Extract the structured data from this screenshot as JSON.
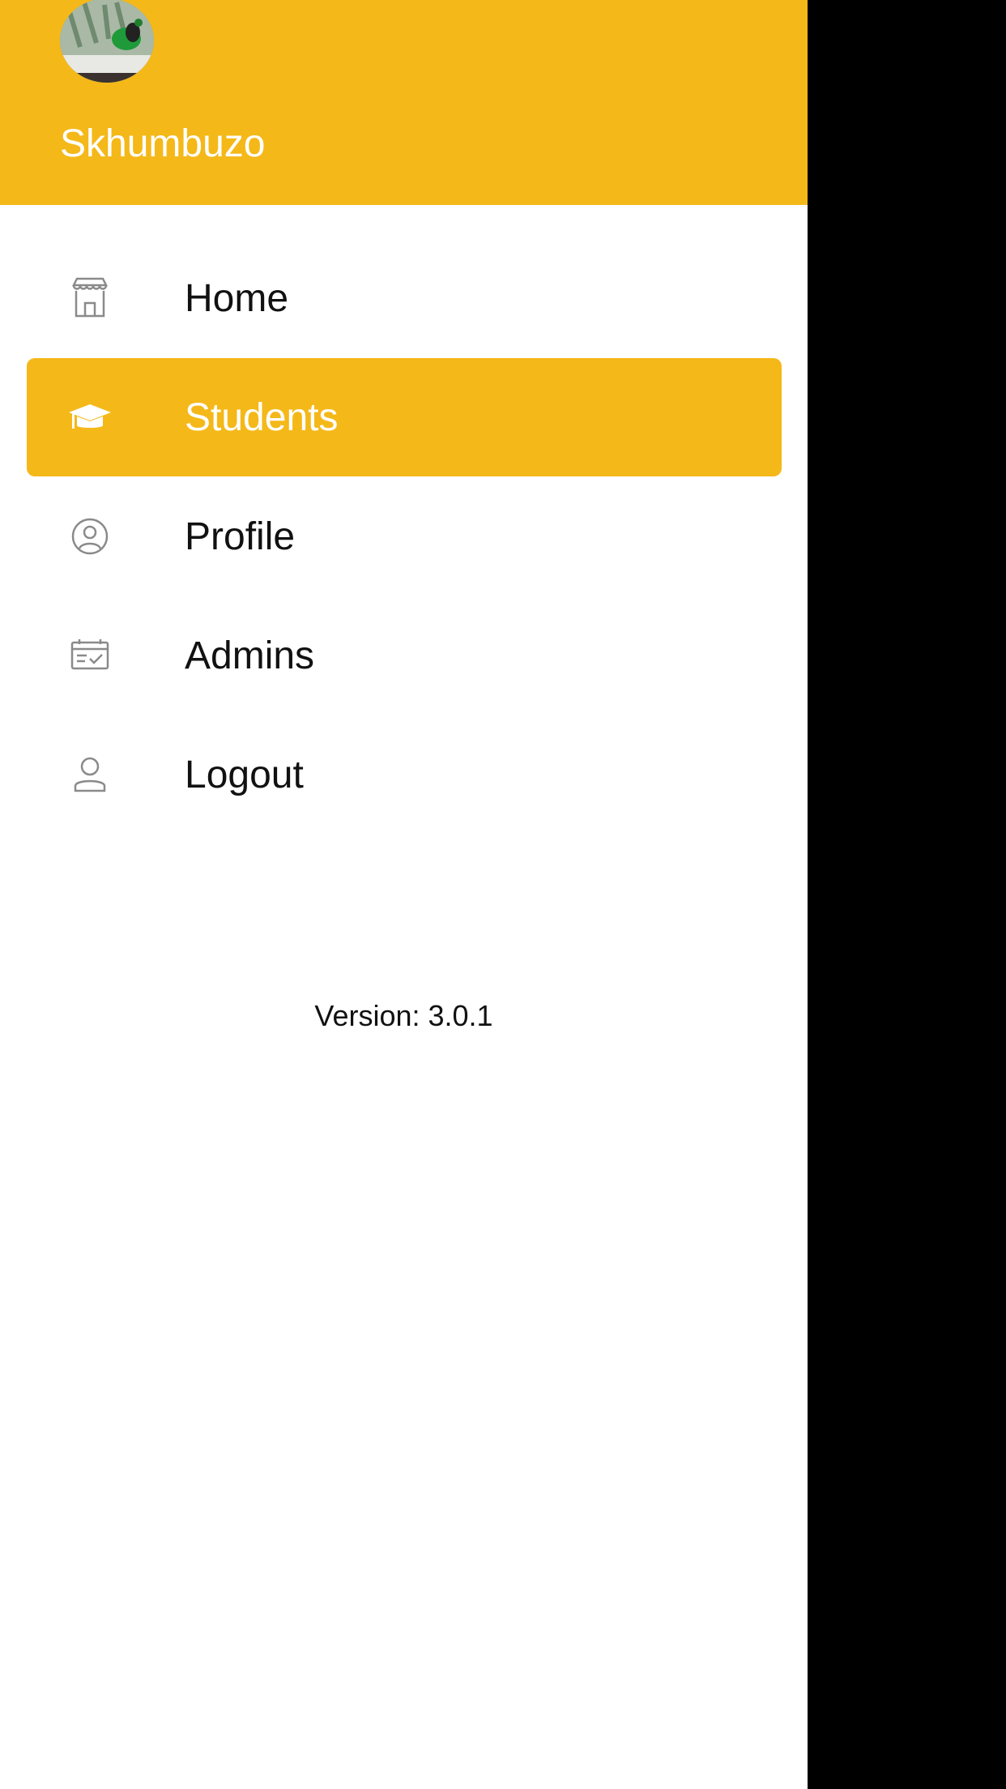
{
  "drawer": {
    "user_name": "Skhumbuzo",
    "header_color": "#F4B819",
    "active_item_color": "#F4B819",
    "items": [
      {
        "label": "Home",
        "icon": "store-icon",
        "active": false
      },
      {
        "label": "Students",
        "icon": "graduation-cap-icon",
        "active": true
      },
      {
        "label": "Profile",
        "icon": "user-circle-icon",
        "active": false
      },
      {
        "label": "Admins",
        "icon": "calendar-check-icon",
        "active": false
      },
      {
        "label": "Logout",
        "icon": "user-icon",
        "active": false
      }
    ],
    "version": "Version: 3.0.1"
  }
}
